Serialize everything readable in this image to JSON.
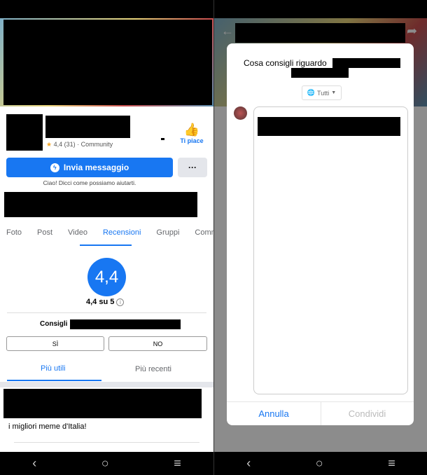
{
  "page": {
    "rating_line": "4,4 (31) · Community",
    "like_label": "Ti piace",
    "message_button": "Invia messaggio",
    "more_button": "···",
    "greeting": "Ciao! Dicci come possiamo aiutarti.",
    "tabs": [
      {
        "label": "Foto"
      },
      {
        "label": "Post"
      },
      {
        "label": "Video"
      },
      {
        "label": "Recensioni",
        "active": true
      },
      {
        "label": "Gruppi"
      },
      {
        "label": "Community"
      }
    ],
    "rating_big": "4,4",
    "rating_out_of": "4,4 su 5",
    "recommend_label": "Consigli",
    "yes": "SÌ",
    "no": "NO",
    "sort_tabs": [
      {
        "label": "Più utili",
        "active": true
      },
      {
        "label": "Più recenti"
      }
    ],
    "post_text": "i migliori meme d'Italia!",
    "accent": "#1877f2"
  },
  "dialog": {
    "title": "Cosa consigli riguardo",
    "audience": "Tutti",
    "cancel": "Annulla",
    "share": "Condividi"
  },
  "nav": {
    "back": "‹",
    "home": "○",
    "menu": "≡"
  }
}
